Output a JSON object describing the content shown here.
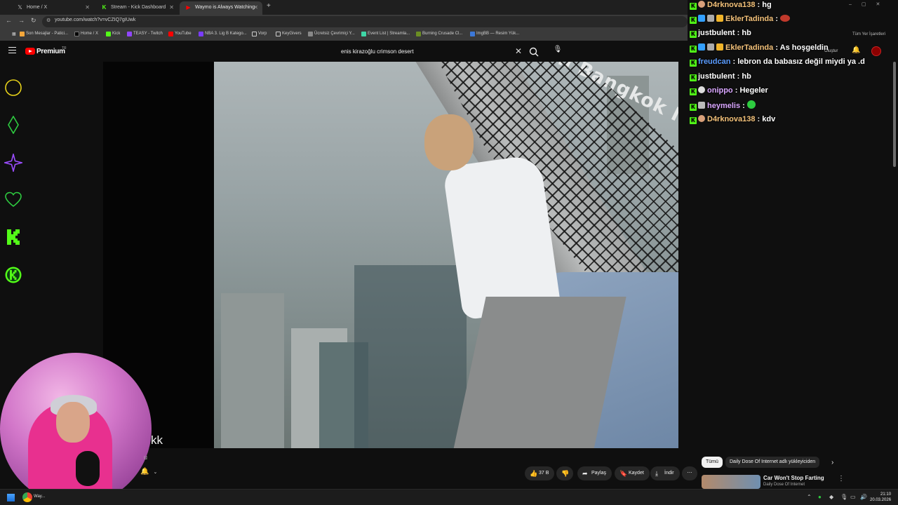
{
  "browser": {
    "tabs": [
      {
        "label": "Home / X",
        "favicon": "x-logo-icon",
        "active": false
      },
      {
        "label": "Stream - Kick Dashboard",
        "favicon": "kick-logo-icon",
        "active": false
      },
      {
        "label": "Waymo is Always Watching",
        "favicon": "youtube-icon",
        "active": true
      }
    ],
    "url": "youtube.com/watch?v=vCZIQ7gIUwk",
    "bookmarks": [
      "Son Mesajlar - Patici...",
      "Home / X",
      "Kick",
      "TEASY - Twitch",
      "YouTube",
      "NBA 3. Lig B Katego...",
      "Vorp",
      "KeyGivers",
      "Ücretsiz Çevrimiçi Y...",
      "Event List | Streamla...",
      "Burning Crusade Cl...",
      "ImgBB — Resim Yük..."
    ],
    "all_bookmarks": "Tüm Yer İşaretleri"
  },
  "youtube": {
    "brand": "Premium",
    "region": "TR",
    "search_value": "enis kirazoğlu crimson desert",
    "create_label": "Oluştur",
    "video_overlay_text": "Mahanakhon Bangkok I-TILT",
    "channel_fragment": "kk",
    "subscriber_fragment": "u",
    "actions": {
      "likes": "37 B",
      "share": "Paylaş",
      "save": "Kaydet",
      "download": "İndir"
    },
    "chips": {
      "all": "Tümü",
      "channel": "Daily Dose Of Internet adlı yükleyiciden"
    },
    "recommendation": {
      "title": "Car Won't Stop Farting",
      "channel": "Daily Dose Of Internet"
    }
  },
  "chat": [
    {
      "user": "D4rknova138",
      "message": "hg",
      "color": "#f4c27a"
    },
    {
      "user": "EklerTadinda",
      "message": "",
      "color": "#f4c27a"
    },
    {
      "user": "justbulent",
      "message": "hb",
      "color": "#ffffff"
    },
    {
      "user": "EklerTadinda",
      "message": "As hoşgeldin",
      "color": "#f4c27a"
    },
    {
      "user": "freudcan",
      "message": "lebron da babasız değil miydi ya .d",
      "color": "#5b9cff"
    },
    {
      "user": "justbulent",
      "message": "hb",
      "color": "#ffffff"
    },
    {
      "user": "onippo",
      "message": "Hegeler",
      "color": "#d9a6ff"
    },
    {
      "user": "heymelis",
      "message": "",
      "color": "#d9a6ff"
    },
    {
      "user": "D4rknova138",
      "message": "kdv",
      "color": "#f4c27a"
    }
  ],
  "taskbar": {
    "app_label": "Way...",
    "time": "21:10",
    "date": "20.03.2026"
  },
  "colors": {
    "kick_green": "#53fc18",
    "youtube_red": "#ff0000",
    "overlay_yellow": "#e7d21a",
    "overlay_green": "#2ecc40",
    "overlay_purple": "#9b4dff"
  }
}
